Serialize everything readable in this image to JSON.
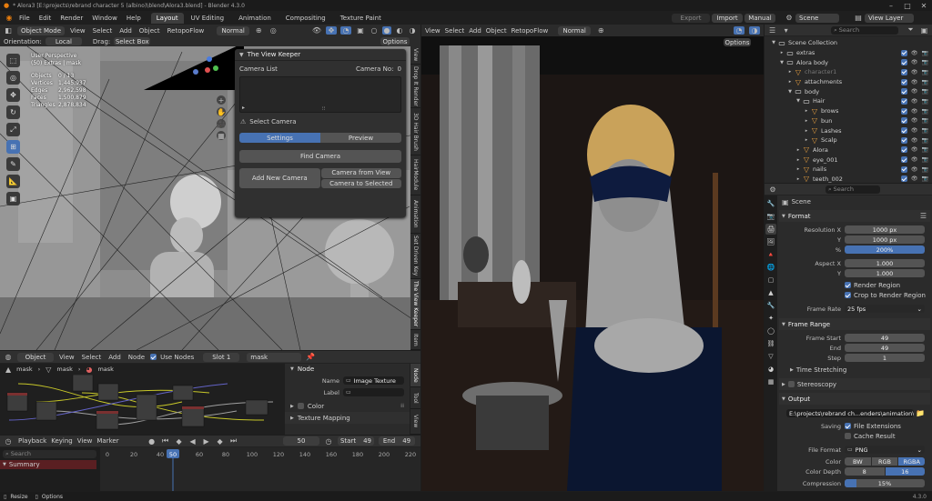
{
  "title": "* Alora3 [E:\\projects\\rebrand character 5 (albino)\\blend\\Alora3.blend] - Blender 4.3.0",
  "menu": [
    "File",
    "Edit",
    "Render",
    "Window",
    "Help"
  ],
  "workspaces": [
    "Layout",
    "UV Editing",
    "Animation",
    "Compositing",
    "Texture Paint"
  ],
  "top_right": {
    "export": "Export",
    "import": "Import",
    "manual": "Manual",
    "scene": "Scene",
    "view_layer": "View Layer"
  },
  "left_viewport": {
    "mode": "Object Mode",
    "menus": [
      "View",
      "Select",
      "Add",
      "Object",
      "RetopoFlow"
    ],
    "shading": "Normal",
    "orientation_label": "Orientation:",
    "orientation": "Local",
    "drag_label": "Drag:",
    "drag": "Select Box",
    "options": "Options",
    "overlay": [
      "User Perspective",
      "(50) Extras | mask"
    ],
    "stats": [
      [
        "Objects",
        "0 / 13"
      ],
      [
        "Vertices",
        "1,445,937"
      ],
      [
        "Edges",
        "2,962,598"
      ],
      [
        "Faces",
        "1,500,879"
      ],
      [
        "Triangles",
        "2,878,834"
      ]
    ],
    "tabs": [
      "View",
      "Drop It Render",
      "3D Hair Brush",
      "HairModule",
      "Animation",
      "Set Driven Key",
      "The View Keeper",
      "Item"
    ]
  },
  "view_keeper": {
    "title": "The View Keeper",
    "camera_list": "Camera List",
    "camera_no_label": "Camera No:",
    "camera_no": "0",
    "select_camera": "Select Camera",
    "tab_settings": "Settings",
    "tab_preview": "Preview",
    "find_camera": "Find Camera",
    "add_new_camera": "Add New Camera",
    "camera_from_view": "Camera from View",
    "camera_to_selected": "Camera to Selected"
  },
  "right_viewport": {
    "menus": [
      "View",
      "Select",
      "Add",
      "Object",
      "RetopoFlow"
    ],
    "shading": "Normal",
    "options": "Options"
  },
  "node_editor": {
    "editor": "Object",
    "menus": [
      "View",
      "Select",
      "Add",
      "Node"
    ],
    "use_nodes": "Use Nodes",
    "slot": "Slot 1",
    "material": "mask",
    "breadcrumb": [
      "mask",
      "mask",
      "mask"
    ],
    "panel_title": "Node",
    "name_label": "Name",
    "name_value": "Image Texture",
    "label_label": "Label",
    "color": "Color",
    "texture_mapping": "Texture Mapping",
    "tabs": [
      "Node",
      "Tool",
      "View"
    ]
  },
  "timeline": {
    "menus": [
      "Playback",
      "Keying",
      "View",
      "Marker"
    ],
    "current": "50",
    "start_label": "Start",
    "start": "49",
    "end_label": "End",
    "end": "49",
    "ticks": [
      "0",
      "20",
      "40",
      "50",
      "60",
      "80",
      "100",
      "120",
      "140",
      "160",
      "180",
      "200",
      "220",
      "240"
    ],
    "summary": "Summary",
    "bottom_menus": [
      "View",
      "Select",
      "Marker",
      "Channel",
      "Key"
    ],
    "normalize": "Normalize"
  },
  "outliner": {
    "search": "Search",
    "items": [
      {
        "name": "Scene Collection",
        "indent": 0
      },
      {
        "name": "extras",
        "indent": 1
      },
      {
        "name": "Alora body",
        "indent": 1
      },
      {
        "name": "character1",
        "indent": 2
      },
      {
        "name": "attachments",
        "indent": 2
      },
      {
        "name": "body",
        "indent": 2
      },
      {
        "name": "Hair",
        "indent": 3
      },
      {
        "name": "brows",
        "indent": 4
      },
      {
        "name": "bun",
        "indent": 4
      },
      {
        "name": "Lashes",
        "indent": 4
      },
      {
        "name": "Scalp",
        "indent": 4
      },
      {
        "name": "Alora",
        "indent": 3
      },
      {
        "name": "eye_001",
        "indent": 3
      },
      {
        "name": "nails",
        "indent": 3
      },
      {
        "name": "teeth_002",
        "indent": 3
      }
    ]
  },
  "properties": {
    "search": "Search",
    "scene": "Scene",
    "format": {
      "title": "Format",
      "res_x_label": "Resolution X",
      "res_x": "1000 px",
      "res_y_label": "Y",
      "res_y": "1000 px",
      "pct_label": "%",
      "pct": "200%",
      "aspect_x_label": "Aspect X",
      "aspect_x": "1.000",
      "aspect_y_label": "Y",
      "aspect_y": "1.000",
      "render_region": "Render Region",
      "crop": "Crop to Render Region",
      "frame_rate_label": "Frame Rate",
      "frame_rate": "25 fps"
    },
    "frame_range": {
      "title": "Frame Range",
      "start_label": "Frame Start",
      "start": "49",
      "end_label": "End",
      "end": "49",
      "step_label": "Step",
      "step": "1",
      "time_stretching": "Time Stretching"
    },
    "stereoscopy": "Stereoscopy",
    "output": {
      "title": "Output",
      "path": "E:\\projects\\rebrand ch...enders\\animation\\Alora",
      "saving_label": "Saving",
      "file_ext": "File Extensions",
      "cache": "Cache Result",
      "file_format_label": "File Format",
      "file_format": "PNG",
      "color_label": "Color",
      "color_bw": "BW",
      "color_rgb": "RGB",
      "color_rgba": "RGBA",
      "depth_label": "Color Depth",
      "depth_8": "8",
      "depth_16": "16",
      "compression_label": "Compression",
      "compression": "15%"
    }
  },
  "status": {
    "resize": "Resize",
    "options": "Options",
    "version": "4.3.0"
  }
}
